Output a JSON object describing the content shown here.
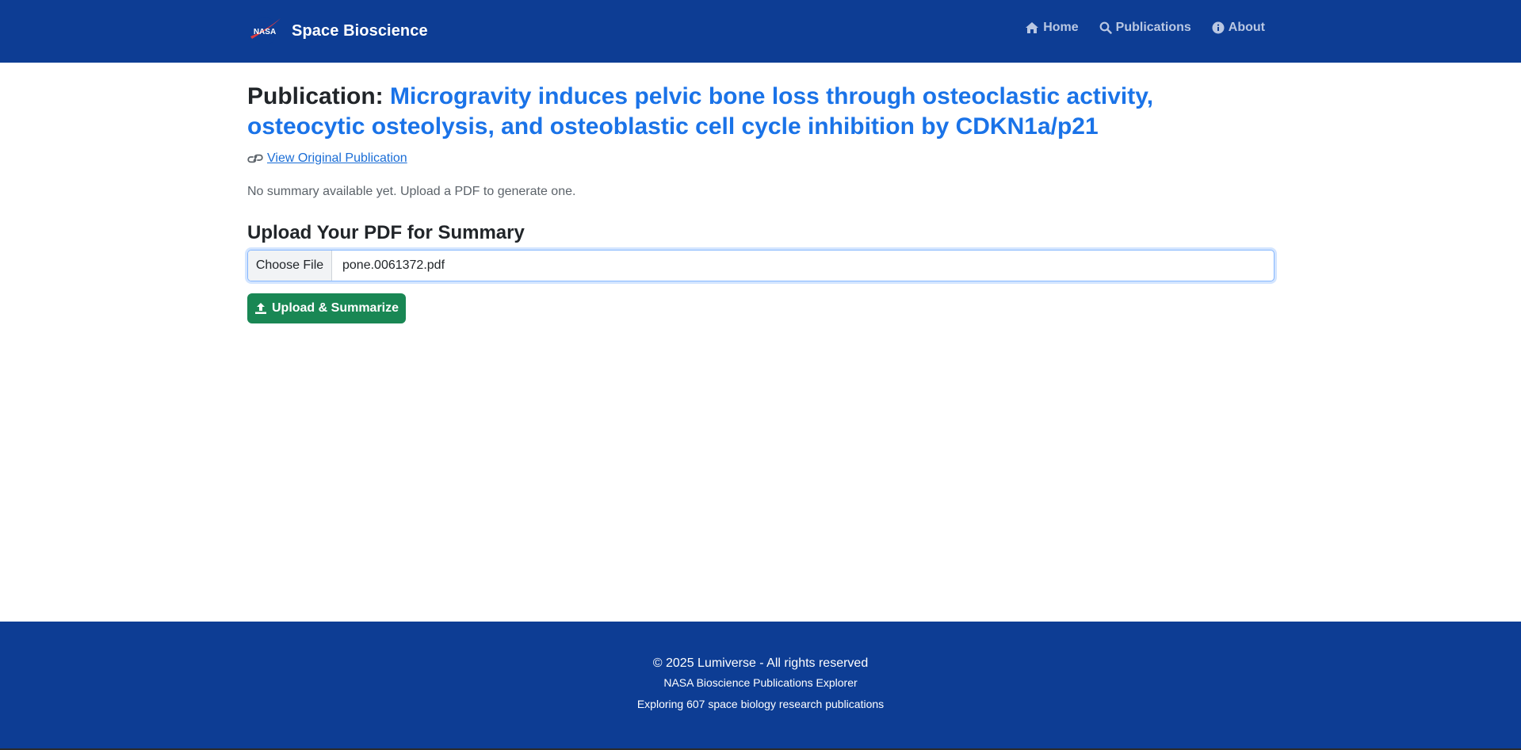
{
  "navbar": {
    "brand": "Space Bioscience",
    "logo_text": "NASA",
    "links": [
      {
        "label": "Home",
        "icon": "home-icon"
      },
      {
        "label": "Publications",
        "icon": "search-icon"
      },
      {
        "label": "About",
        "icon": "info-circle-icon"
      }
    ]
  },
  "publication": {
    "prefix": "Publication:",
    "title": "Microgravity induces pelvic bone loss through osteoclastic activity, osteocytic osteolysis, and osteoblastic cell cycle inhibition by CDKN1a/p21",
    "view_link_label": "View Original Publication",
    "summary_text": "No summary available yet. Upload a PDF to generate one."
  },
  "upload": {
    "heading": "Upload Your PDF for Summary",
    "choose_label": "Choose File",
    "file_name": "pone.0061372.pdf",
    "button_label": "Upload & Summarize"
  },
  "footer": {
    "copyright": "© 2025 Lumiverse - All rights reserved",
    "subtitle": "NASA Bioscience Publications Explorer",
    "count_text": "Exploring 607 space biology research publications"
  },
  "colors": {
    "navbar_bg": "#0d3d94",
    "link_blue": "#1a73e8",
    "success_green": "#198754"
  }
}
